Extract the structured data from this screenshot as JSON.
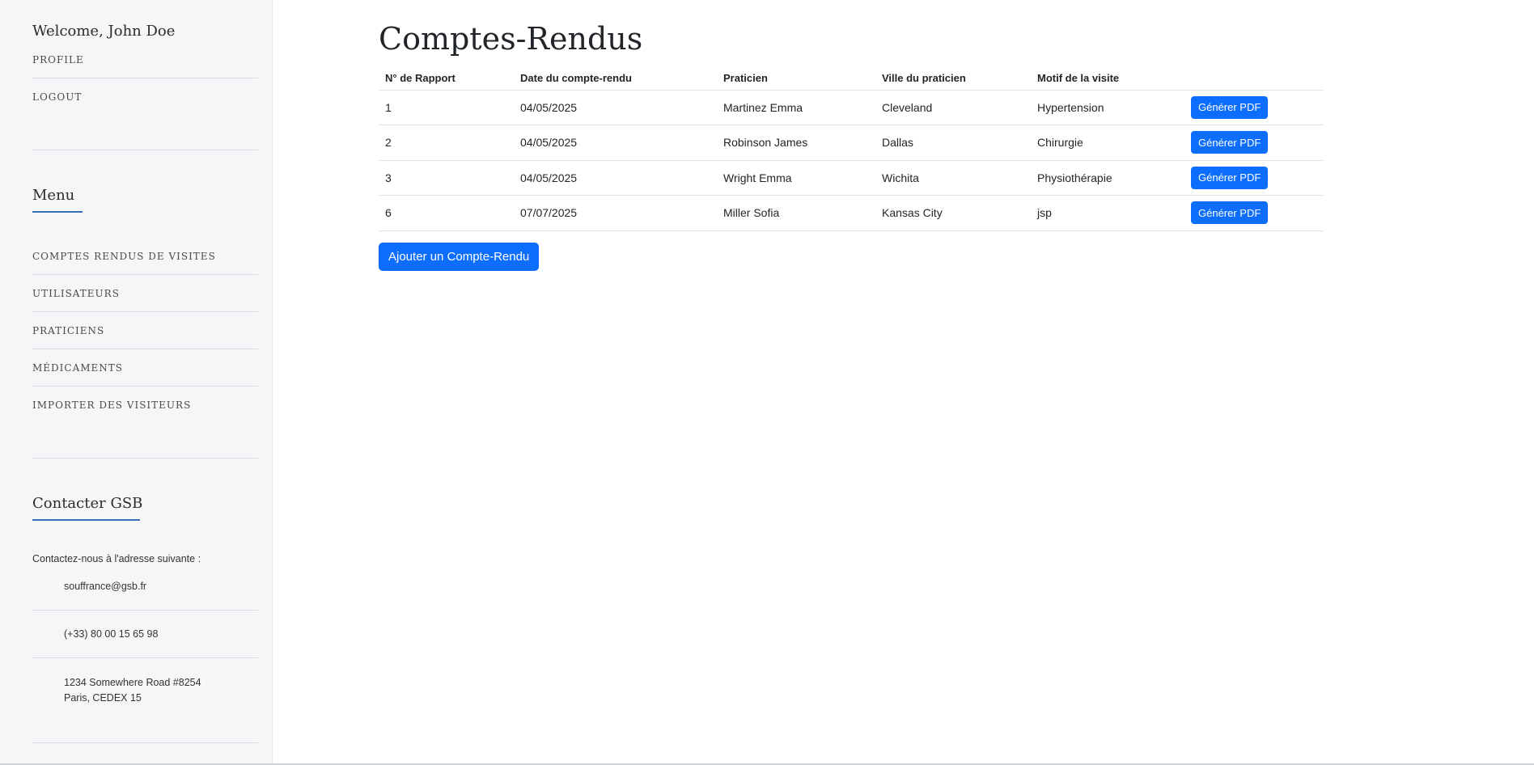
{
  "sidebar": {
    "welcome": "Welcome, John Doe",
    "top_links": [
      "PROFILE",
      "LOGOUT"
    ],
    "menu_title": "Menu",
    "menu_items": [
      "COMPTES RENDUS DE VISITES",
      "UTILISATEURS",
      "PRATICIENS",
      "MÉDICAMENTS",
      "IMPORTER DES VISITEURS"
    ],
    "contact_title": "Contacter GSB",
    "contact_intro": "Contactez-nous à l'adresse suivante :",
    "email": "souffrance@gsb.fr",
    "phone": "(+33) 80 00 15 65 98",
    "address_line1": "1234 Somewhere Road #8254",
    "address_line2": "Paris, CEDEX 15"
  },
  "main": {
    "title": "Comptes-Rendus",
    "columns": [
      "N° de Rapport",
      "Date du compte-rendu",
      "Praticien",
      "Ville du praticien",
      "Motif de la visite",
      ""
    ],
    "rows": [
      {
        "id": "1",
        "date": "04/05/2025",
        "praticien": "Martinez Emma",
        "ville": "Cleveland",
        "motif": "Hypertension"
      },
      {
        "id": "2",
        "date": "04/05/2025",
        "praticien": "Robinson James",
        "ville": "Dallas",
        "motif": "Chirurgie"
      },
      {
        "id": "3",
        "date": "04/05/2025",
        "praticien": "Wright Emma",
        "ville": "Wichita",
        "motif": "Physiothérapie"
      },
      {
        "id": "6",
        "date": "07/07/2025",
        "praticien": "Miller Sofia",
        "ville": "Kansas City",
        "motif": "jsp"
      }
    ],
    "pdf_label": "Générer PDF",
    "add_label": "Ajouter un Compte-Rendu"
  },
  "colors": {
    "primary": "#0d6efd",
    "sidebar_bg": "#f5f6f8",
    "accent_underline": "#3a6fb5"
  }
}
